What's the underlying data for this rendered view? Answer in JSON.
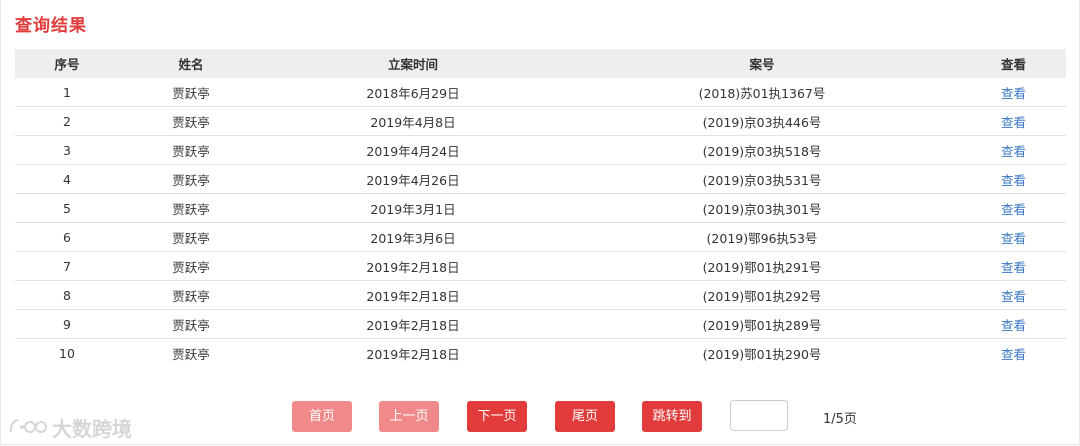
{
  "page": {
    "title": "查询结果"
  },
  "table": {
    "headers": {
      "idx": "序号",
      "name": "姓名",
      "date": "立案时间",
      "case": "案号",
      "view": "查看"
    },
    "rows": [
      {
        "idx": "1",
        "name": "贾跃亭",
        "date": "2018年6月29日",
        "case": "(2018)苏01执1367号",
        "view": "查看"
      },
      {
        "idx": "2",
        "name": "贾跃亭",
        "date": "2019年4月8日",
        "case": "(2019)京03执446号",
        "view": "查看"
      },
      {
        "idx": "3",
        "name": "贾跃亭",
        "date": "2019年4月24日",
        "case": "(2019)京03执518号",
        "view": "查看"
      },
      {
        "idx": "4",
        "name": "贾跃亭",
        "date": "2019年4月26日",
        "case": "(2019)京03执531号",
        "view": "查看"
      },
      {
        "idx": "5",
        "name": "贾跃亭",
        "date": "2019年3月1日",
        "case": "(2019)京03执301号",
        "view": "查看"
      },
      {
        "idx": "6",
        "name": "贾跃亭",
        "date": "2019年3月6日",
        "case": "(2019)鄂96执53号",
        "view": "查看"
      },
      {
        "idx": "7",
        "name": "贾跃亭",
        "date": "2019年2月18日",
        "case": "(2019)鄂01执291号",
        "view": "查看"
      },
      {
        "idx": "8",
        "name": "贾跃亭",
        "date": "2019年2月18日",
        "case": "(2019)鄂01执292号",
        "view": "查看"
      },
      {
        "idx": "9",
        "name": "贾跃亭",
        "date": "2019年2月18日",
        "case": "(2019)鄂01执289号",
        "view": "查看"
      },
      {
        "idx": "10",
        "name": "贾跃亭",
        "date": "2019年2月18日",
        "case": "(2019)鄂01执290号",
        "view": "查看"
      }
    ]
  },
  "pagination": {
    "first_label": "首页",
    "prev_label": "上一页",
    "next_label": "下一页",
    "last_label": "尾页",
    "jump_label": "跳转到",
    "jump_value": "",
    "page_info": "1/5页"
  },
  "watermark": {
    "text": "大数跨境",
    "icon": "ido-logo-icon"
  },
  "colors": {
    "accent": "#e23b3b",
    "accent_disabled": "#f08a8a",
    "link": "#3a78c3",
    "header_bg": "#eeeeee"
  }
}
